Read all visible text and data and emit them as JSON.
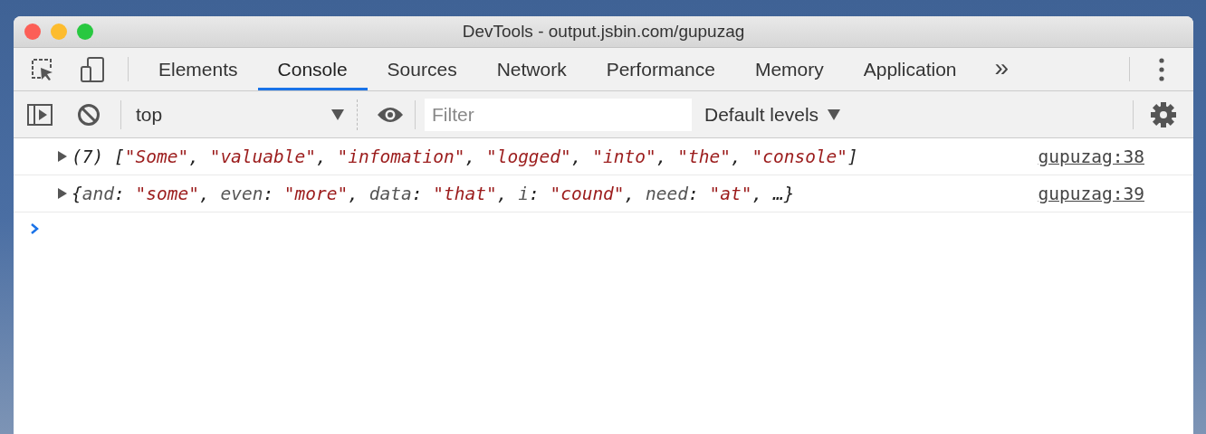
{
  "window": {
    "title": "DevTools - output.jsbin.com/gupuzag"
  },
  "tabs": [
    {
      "label": "Elements",
      "selected": false
    },
    {
      "label": "Console",
      "selected": true
    },
    {
      "label": "Sources",
      "selected": false
    },
    {
      "label": "Network",
      "selected": false
    },
    {
      "label": "Performance",
      "selected": false
    },
    {
      "label": "Memory",
      "selected": false
    },
    {
      "label": "Application",
      "selected": false
    }
  ],
  "more_tabs": "»",
  "console_toolbar": {
    "context": "top",
    "filter": {
      "placeholder": "Filter"
    },
    "levels": "Default levels"
  },
  "messages": [
    {
      "expanded": false,
      "source": "gupuzag:38",
      "tokens": [
        {
          "kind": "plain",
          "text": "(7) ["
        },
        {
          "kind": "string",
          "text": "\"Some\""
        },
        {
          "kind": "plain",
          "text": ", "
        },
        {
          "kind": "string",
          "text": "\"valuable\""
        },
        {
          "kind": "plain",
          "text": ", "
        },
        {
          "kind": "string",
          "text": "\"infomation\""
        },
        {
          "kind": "plain",
          "text": ", "
        },
        {
          "kind": "string",
          "text": "\"logged\""
        },
        {
          "kind": "plain",
          "text": ", "
        },
        {
          "kind": "string",
          "text": "\"into\""
        },
        {
          "kind": "plain",
          "text": ", "
        },
        {
          "kind": "string",
          "text": "\"the\""
        },
        {
          "kind": "plain",
          "text": ", "
        },
        {
          "kind": "string",
          "text": "\"console\""
        },
        {
          "kind": "plain",
          "text": "]"
        }
      ]
    },
    {
      "expanded": false,
      "source": "gupuzag:39",
      "tokens": [
        {
          "kind": "plain",
          "text": "{"
        },
        {
          "kind": "key",
          "text": "and"
        },
        {
          "kind": "plain",
          "text": ": "
        },
        {
          "kind": "string",
          "text": "\"some\""
        },
        {
          "kind": "plain",
          "text": ", "
        },
        {
          "kind": "key",
          "text": "even"
        },
        {
          "kind": "plain",
          "text": ": "
        },
        {
          "kind": "string",
          "text": "\"more\""
        },
        {
          "kind": "plain",
          "text": ", "
        },
        {
          "kind": "key",
          "text": "data"
        },
        {
          "kind": "plain",
          "text": ": "
        },
        {
          "kind": "string",
          "text": "\"that\""
        },
        {
          "kind": "plain",
          "text": ", "
        },
        {
          "kind": "key",
          "text": "i"
        },
        {
          "kind": "plain",
          "text": ": "
        },
        {
          "kind": "string",
          "text": "\"cound\""
        },
        {
          "kind": "plain",
          "text": ", "
        },
        {
          "kind": "key",
          "text": "need"
        },
        {
          "kind": "plain",
          "text": ": "
        },
        {
          "kind": "string",
          "text": "\"at\""
        },
        {
          "kind": "plain",
          "text": ", …}"
        }
      ]
    }
  ]
}
